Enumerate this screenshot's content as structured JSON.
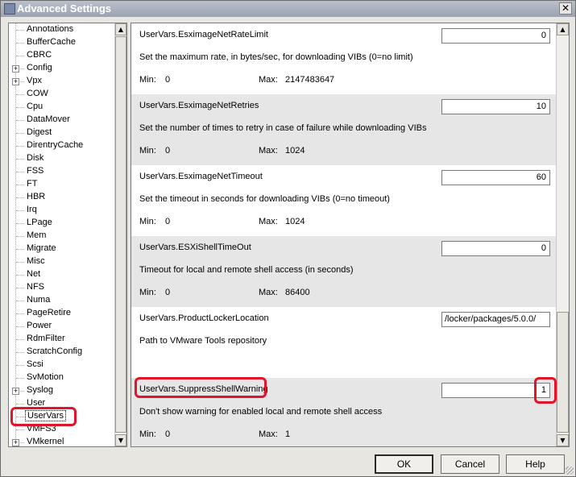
{
  "window": {
    "title": "Advanced Settings",
    "close_glyph": "✕"
  },
  "tree": {
    "items": [
      {
        "label": "Annotations",
        "expandable": false
      },
      {
        "label": "BufferCache",
        "expandable": false
      },
      {
        "label": "CBRC",
        "expandable": false
      },
      {
        "label": "Config",
        "expandable": true
      },
      {
        "label": "Vpx",
        "expandable": true
      },
      {
        "label": "COW",
        "expandable": false
      },
      {
        "label": "Cpu",
        "expandable": false
      },
      {
        "label": "DataMover",
        "expandable": false
      },
      {
        "label": "Digest",
        "expandable": false
      },
      {
        "label": "DirentryCache",
        "expandable": false
      },
      {
        "label": "Disk",
        "expandable": false
      },
      {
        "label": "FSS",
        "expandable": false
      },
      {
        "label": "FT",
        "expandable": false
      },
      {
        "label": "HBR",
        "expandable": false
      },
      {
        "label": "Irq",
        "expandable": false
      },
      {
        "label": "LPage",
        "expandable": false
      },
      {
        "label": "Mem",
        "expandable": false
      },
      {
        "label": "Migrate",
        "expandable": false
      },
      {
        "label": "Misc",
        "expandable": false
      },
      {
        "label": "Net",
        "expandable": false
      },
      {
        "label": "NFS",
        "expandable": false
      },
      {
        "label": "Numa",
        "expandable": false
      },
      {
        "label": "PageRetire",
        "expandable": false
      },
      {
        "label": "Power",
        "expandable": false
      },
      {
        "label": "RdmFilter",
        "expandable": false
      },
      {
        "label": "ScratchConfig",
        "expandable": false
      },
      {
        "label": "Scsi",
        "expandable": false
      },
      {
        "label": "SvMotion",
        "expandable": false
      },
      {
        "label": "Syslog",
        "expandable": true
      },
      {
        "label": "User",
        "expandable": false
      },
      {
        "label": "UserVars",
        "expandable": false,
        "selected": true
      },
      {
        "label": "VMFS3",
        "expandable": false
      },
      {
        "label": "VMkernel",
        "expandable": true
      }
    ]
  },
  "settings": {
    "min_label": "Min:",
    "max_label": "Max:",
    "rows": [
      {
        "name": "UserVars.EsximageNetRateLimit",
        "value": "0",
        "desc": "Set the maximum rate, in bytes/sec, for downloading VIBs (0=no limit)",
        "min": "0",
        "max": "2147483647"
      },
      {
        "name": "UserVars.EsximageNetRetries",
        "value": "10",
        "desc": "Set the number of times to retry in case of failure while downloading VIBs",
        "min": "0",
        "max": "1024"
      },
      {
        "name": "UserVars.EsximageNetTimeout",
        "value": "60",
        "desc": "Set the timeout in seconds for downloading VIBs (0=no timeout)",
        "min": "0",
        "max": "1024"
      },
      {
        "name": "UserVars.ESXiShellTimeOut",
        "value": "0",
        "desc": "Timeout for local and remote shell access (in seconds)",
        "min": "0",
        "max": "86400"
      },
      {
        "name": "UserVars.ProductLockerLocation",
        "value": "/locker/packages/5.0.0/",
        "desc": "Path to VMware Tools repository",
        "min": "",
        "max": ""
      },
      {
        "name": "UserVars.SuppressShellWarning",
        "value": "1",
        "desc": "Don't show warning for enabled local and remote shell access",
        "min": "0",
        "max": "1"
      }
    ]
  },
  "buttons": {
    "ok": "OK",
    "cancel": "Cancel",
    "help": "Help"
  },
  "colors": {
    "highlight": "#e0142a",
    "alt_row": "#e6e6e6"
  }
}
